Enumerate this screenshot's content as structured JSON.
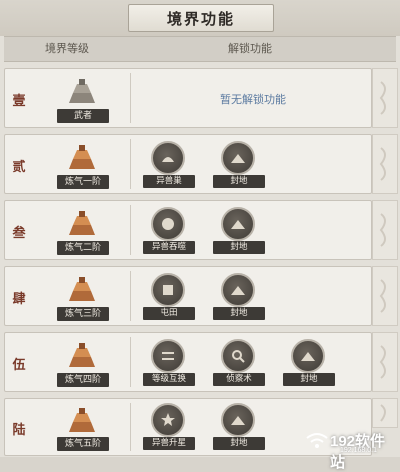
{
  "title": "境界功能",
  "header": {
    "col_realm": "境界等级",
    "col_unlock": "解锁功能"
  },
  "rows": [
    {
      "rank": "壹",
      "realm": "武者",
      "features": [],
      "empty_text": "暂无解锁功能"
    },
    {
      "rank": "贰",
      "realm": "炼气一阶",
      "features": [
        {
          "label": "异兽巢",
          "icon": "beast-nest-icon"
        },
        {
          "label": "封地",
          "icon": "fief-icon"
        }
      ]
    },
    {
      "rank": "叁",
      "realm": "炼气二阶",
      "features": [
        {
          "label": "异兽吞噬",
          "icon": "beast-devour-icon"
        },
        {
          "label": "封地",
          "icon": "fief-icon"
        }
      ]
    },
    {
      "rank": "肆",
      "realm": "炼气三阶",
      "features": [
        {
          "label": "屯田",
          "icon": "farming-icon"
        },
        {
          "label": "封地",
          "icon": "fief-icon"
        }
      ]
    },
    {
      "rank": "伍",
      "realm": "炼气四阶",
      "features": [
        {
          "label": "等级互换",
          "icon": "level-swap-icon"
        },
        {
          "label": "侦察术",
          "icon": "scout-icon"
        },
        {
          "label": "封地",
          "icon": "fief-icon"
        }
      ]
    },
    {
      "rank": "陆",
      "realm": "炼气五阶",
      "features": [
        {
          "label": "异兽升星",
          "icon": "beast-star-icon"
        },
        {
          "label": "封地",
          "icon": "fief-icon"
        }
      ]
    }
  ],
  "watermark": {
    "text": "192软件站",
    "sub": "192.168.0.1"
  },
  "colors": {
    "label_bg": "#3d3a36",
    "numeral": "#7a3a2a",
    "empty_text": "#5b7aa0"
  }
}
